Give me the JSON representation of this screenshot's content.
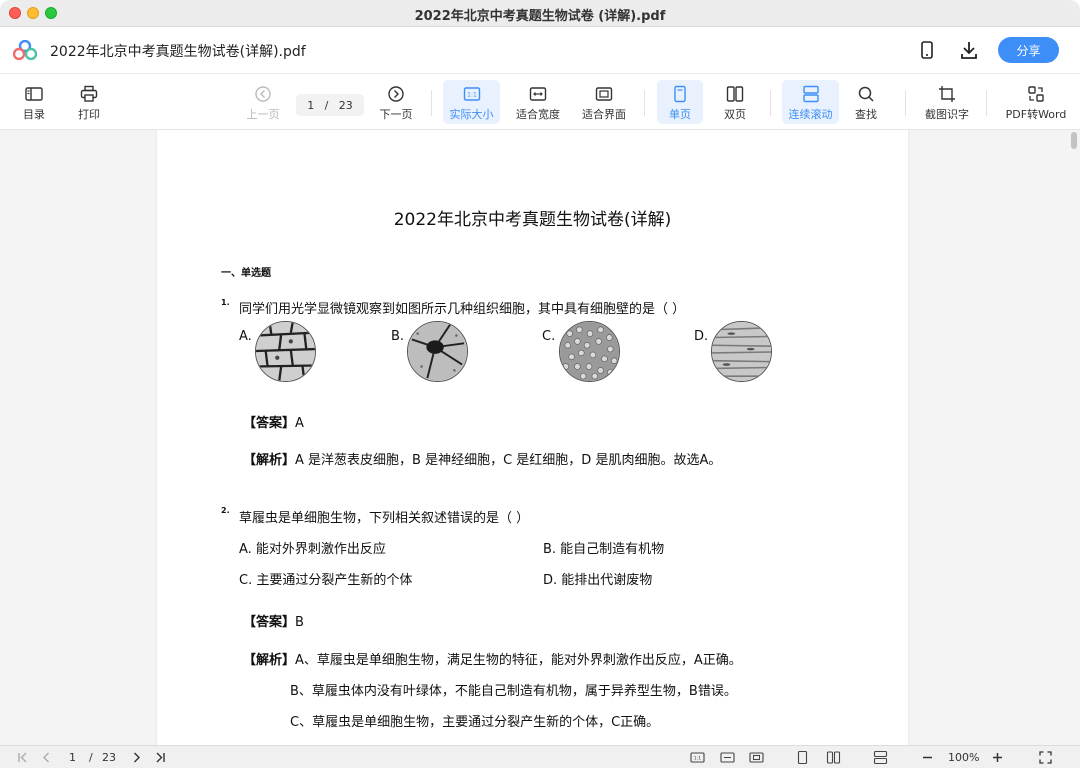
{
  "window": {
    "title": "2022年北京中考真题生物试卷 (详解).pdf"
  },
  "header": {
    "doc_name": "2022年北京中考真题生物试卷(详解).pdf",
    "share_label": "分享"
  },
  "toolbar": {
    "toc": "目录",
    "print": "打印",
    "prev": "上一页",
    "current_page": "1",
    "page_sep": "/",
    "total_pages": "23",
    "next": "下一页",
    "actual_size": "实际大小",
    "fit_width": "适合宽度",
    "fit_page": "适合界面",
    "single": "单页",
    "double": "双页",
    "continuous": "连续滚动",
    "find": "查找",
    "ocr": "截图识字",
    "to_word": "PDF转Word"
  },
  "document": {
    "title": "2022年北京中考真题生物试卷(详解)",
    "section": "一、单选题",
    "q1": {
      "num": "1.",
      "text": "同学们用光学显微镜观察到如图所示几种组织细胞，其中具有细胞壁的是（    ）",
      "options": [
        "A.",
        "B.",
        "C.",
        "D."
      ],
      "answer_label": "【答案】",
      "answer": "A",
      "analysis_label": "【解析】",
      "analysis": "A 是洋葱表皮细胞，B 是神经细胞，C 是红细胞，D 是肌肉细胞。故选A。"
    },
    "q2": {
      "num": "2.",
      "text": "草履虫是单细胞生物，下列相关叙述错误的是（    ）",
      "options": [
        "A. 能对外界刺激作出反应",
        "B. 能自己制造有机物",
        "C. 主要通过分裂产生新的个体",
        "D. 能排出代谢废物"
      ],
      "answer_label": "【答案】",
      "answer": "B",
      "analysis_label": "【解析】",
      "analysis_lines": [
        "A、草履虫是单细胞生物，满足生物的特征，能对外界刺激作出反应，A正确。",
        "B、草履虫体内没有叶绿体，不能自己制造有机物，属于异养型生物，B错误。",
        "C、草履虫是单细胞生物，主要通过分裂产生新的个体，C正确。"
      ]
    }
  },
  "statusbar": {
    "current_page": "1",
    "page_sep": "/",
    "total_pages": "23",
    "zoom": "100%"
  },
  "colors": {
    "accent": "#3d8ef7",
    "active_bg": "#e8f1fd"
  }
}
